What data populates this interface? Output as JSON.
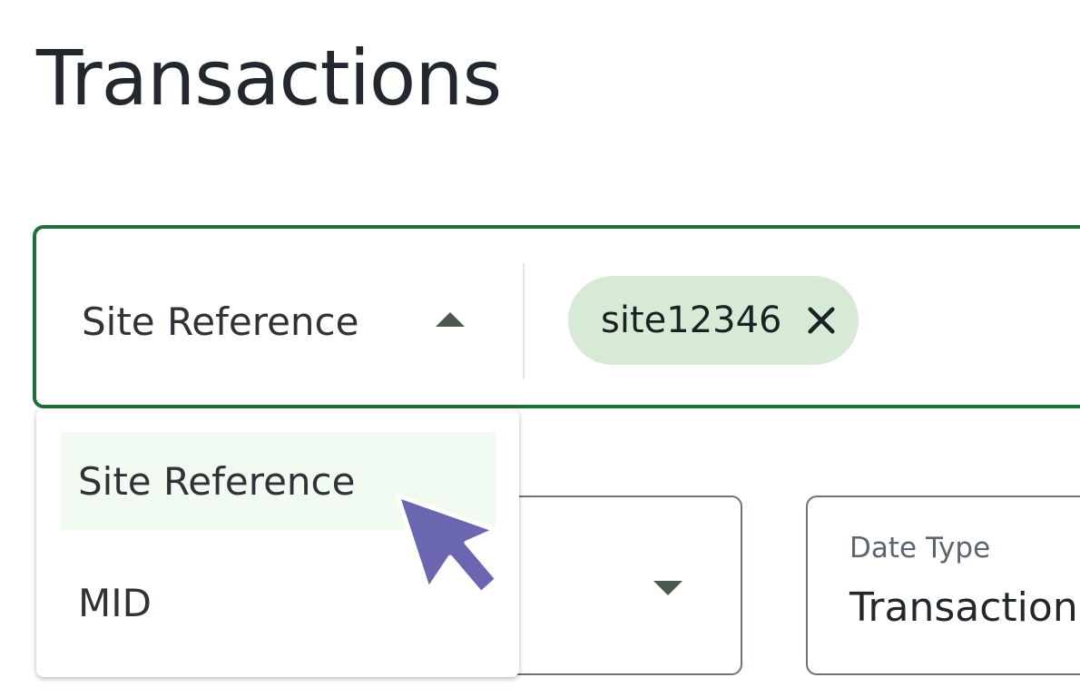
{
  "page": {
    "title": "Transactions"
  },
  "search": {
    "field_selector_label": "Site Reference",
    "chip": {
      "label": "site12346",
      "remove_icon": "close-icon"
    }
  },
  "dropdown": {
    "options": [
      {
        "label": "Site Reference",
        "highlighted": true
      },
      {
        "label": "MID",
        "highlighted": false
      }
    ]
  },
  "fields": {
    "date_type": {
      "label": "Date Type",
      "value": "Transaction"
    }
  },
  "colors": {
    "accent_border": "#1f6f3a",
    "chip_bg": "#d6ead6",
    "highlight_bg": "#f1fbf1",
    "cursor": "#6a67b0"
  }
}
